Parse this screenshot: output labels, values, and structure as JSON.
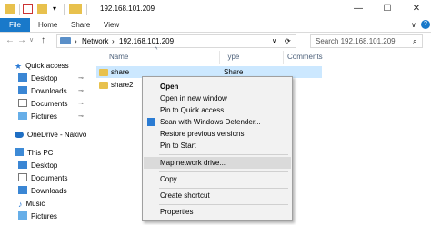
{
  "window": {
    "title": "192.168.101.209",
    "minimize": "—",
    "maximize": "☐",
    "close": "✕"
  },
  "ribbon": {
    "tabs": [
      "File",
      "Home",
      "Share",
      "View"
    ]
  },
  "nav": {
    "back": "←",
    "forward": "→",
    "recent": "∨",
    "up": "↑"
  },
  "address": {
    "crumbs": [
      "Network",
      "192.168.101.209"
    ],
    "separator": "›",
    "dropdown": "∨",
    "refresh": "⟳"
  },
  "search": {
    "placeholder": "Search 192.168.101.209",
    "icon": "⌕"
  },
  "sidebar": {
    "quick_access": "Quick access",
    "quick_items": [
      "Desktop",
      "Downloads",
      "Documents",
      "Pictures"
    ],
    "onedrive": "OneDrive - Nakivo",
    "this_pc": "This PC",
    "pc_items": [
      "Desktop",
      "Documents",
      "Downloads",
      "Music",
      "Pictures"
    ]
  },
  "columns": {
    "name": "Name",
    "type": "Type",
    "comments": "Comments",
    "sort_icon": "^"
  },
  "files": [
    {
      "name": "share",
      "type": "Share"
    },
    {
      "name": "share2",
      "type": ""
    }
  ],
  "context_menu": {
    "items": [
      "Open",
      "Open in new window",
      "Pin to Quick access",
      "Scan with Windows Defender...",
      "Restore previous versions",
      "Pin to Start",
      "Map network drive...",
      "Copy",
      "Create shortcut",
      "Properties"
    ]
  },
  "colors": {
    "accent": "#1979ca",
    "selection": "#cce8ff",
    "folder": "#e8c14d"
  }
}
